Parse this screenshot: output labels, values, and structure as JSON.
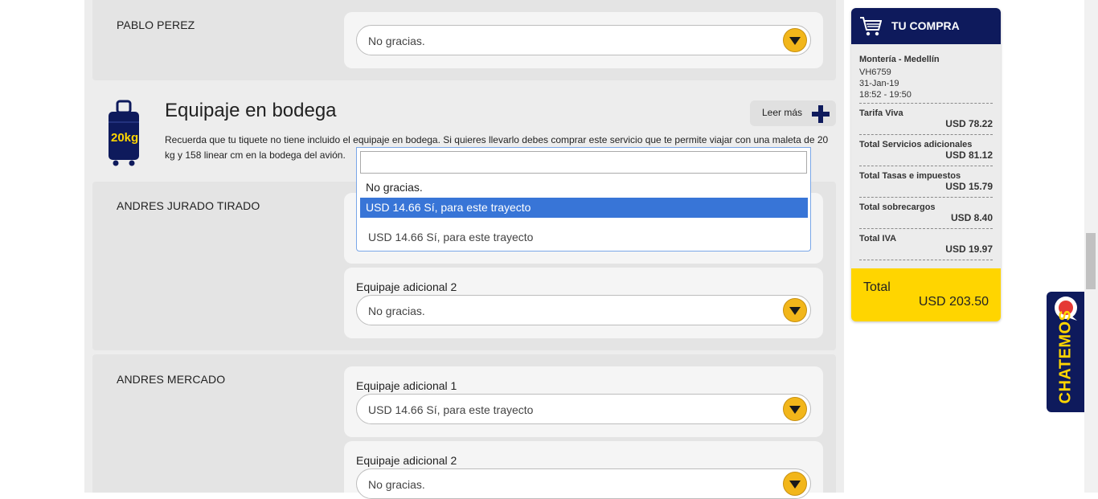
{
  "passengers": {
    "p1": {
      "name": "PABLO PEREZ",
      "select_value": "No gracias."
    },
    "p2": {
      "name": "ANDRES JURADO TIRADO",
      "dropdown_options": [
        "No gracias.",
        "USD 14.66 Sí, para este trayecto"
      ],
      "select_value": "USD 14.66 Sí, para este trayecto",
      "label2": "Equipaje adicional 2",
      "select2_value": "No gracias."
    },
    "p3": {
      "name": "ANDRES MERCADO",
      "label1": "Equipaje adicional 1",
      "select1_value": "USD 14.66 Sí, para este trayecto",
      "label2": "Equipaje adicional 2",
      "select2_value": "No gracias."
    }
  },
  "baggage": {
    "title": "Equipaje en bodega",
    "description": "Recuerda que tu tiquete no tiene incluido el equipaje en bodega. Si quieres llevarlo debes comprar este servicio que te permite viajar con una maleta de 20 kg y 158 linear cm en la bodega del avión.",
    "read_more": "Leer más",
    "icon_text": "20kg"
  },
  "summary": {
    "title": "TU COMPRA",
    "route": "Montería - Medellín",
    "flight": "VH6759",
    "date": "31-Jan-19",
    "time": "18:52 - 19:50",
    "rows": [
      {
        "label": "Tarifa Viva",
        "value": "USD 78.22"
      },
      {
        "label": "Total Servicios adicionales",
        "value": "USD 81.12"
      },
      {
        "label": "Total Tasas e impuestos",
        "value": "USD 15.79"
      },
      {
        "label": "Total sobrecargos",
        "value": "USD 8.40"
      },
      {
        "label": "Total IVA",
        "value": "USD 19.97"
      }
    ],
    "total_label": "Total",
    "total_value": "USD 203.50"
  },
  "chat": {
    "label": "CHATEMOS"
  },
  "colors": {
    "navy": "#0e1a5c",
    "yellow": "#ffd500",
    "arrow": "#f2b61a",
    "highlight": "#3875d7"
  }
}
